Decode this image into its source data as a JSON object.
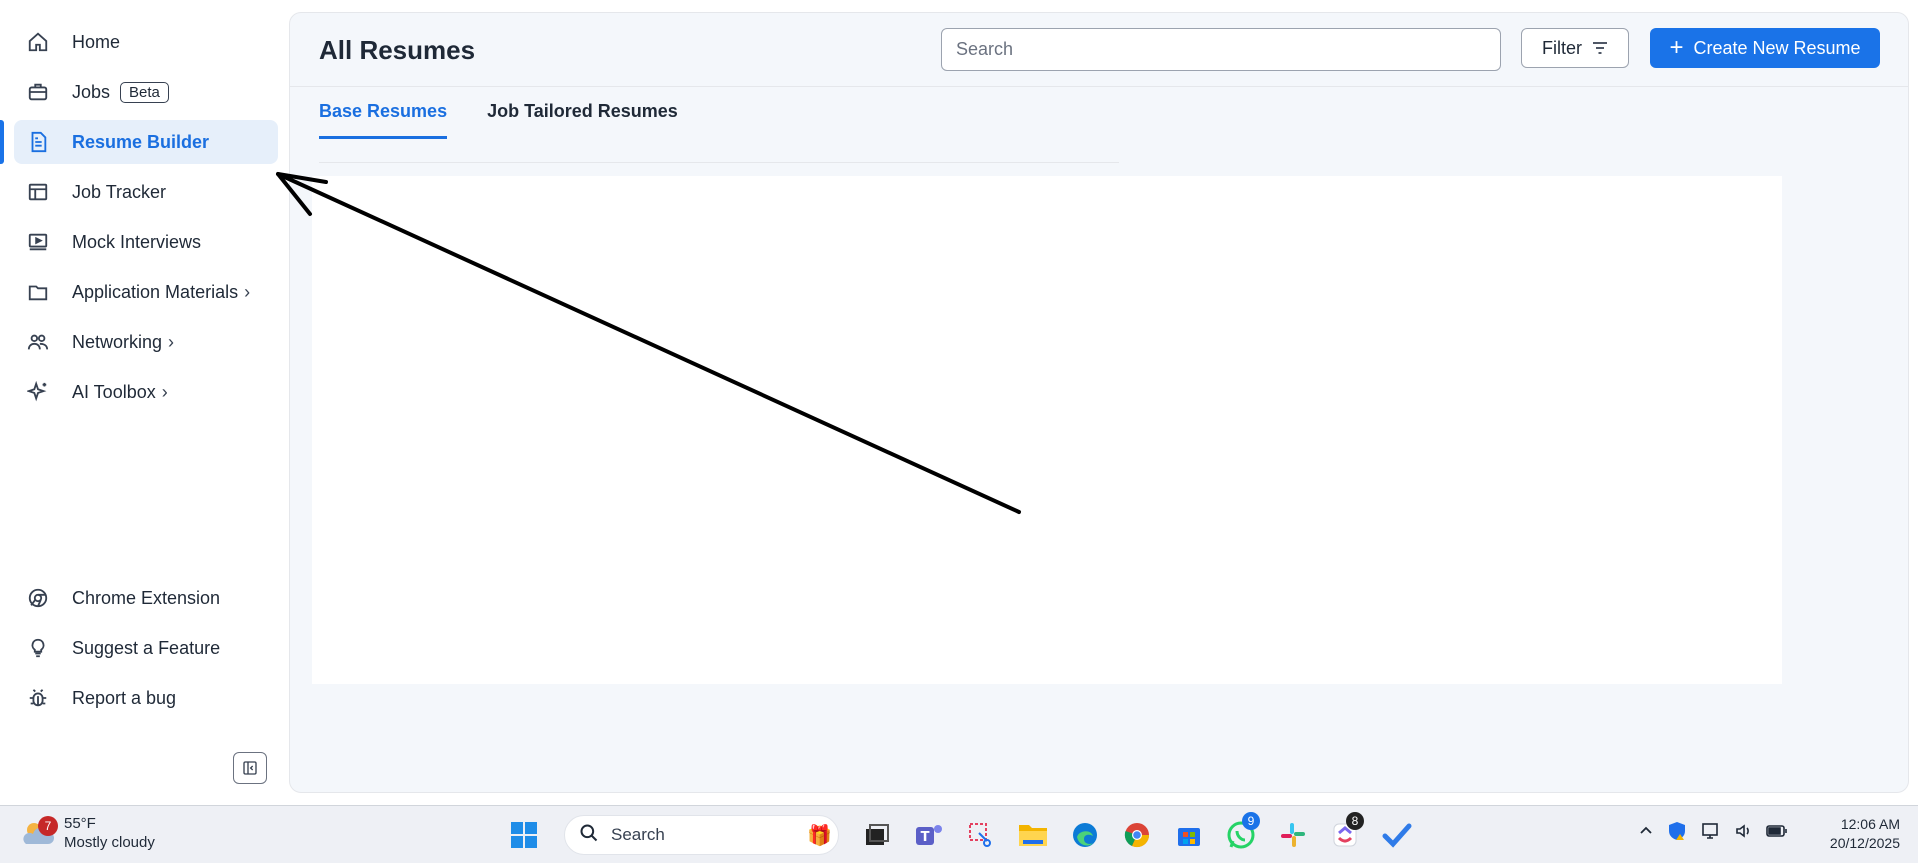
{
  "sidebar": {
    "items": [
      {
        "label": "Home",
        "icon": "home-icon"
      },
      {
        "label": "Jobs",
        "badge": "Beta",
        "icon": "briefcase-icon"
      },
      {
        "label": "Resume Builder",
        "icon": "document-icon",
        "active": true
      },
      {
        "label": "Job Tracker",
        "icon": "table-icon"
      },
      {
        "label": "Mock Interviews",
        "icon": "play-screen-icon"
      },
      {
        "label": "Application Materials",
        "icon": "folder-icon"
      },
      {
        "label": "Networking",
        "icon": "people-icon"
      },
      {
        "label": "AI Toolbox",
        "icon": "sparkle-icon"
      }
    ],
    "bottom_items": [
      {
        "label": "Chrome Extension",
        "icon": "chrome-icon"
      },
      {
        "label": "Suggest a Feature",
        "icon": "lightbulb-icon"
      },
      {
        "label": "Report a bug",
        "icon": "bug-icon"
      }
    ]
  },
  "header": {
    "title": "All Resumes",
    "search_placeholder": "Search",
    "filter_label": "Filter",
    "create_label": "Create New Resume"
  },
  "tabs": [
    {
      "label": "Base Resumes",
      "active": true
    },
    {
      "label": "Job Tailored Resumes"
    }
  ],
  "taskbar": {
    "weather": {
      "badge": "7",
      "temp": "55°F",
      "condition": "Mostly cloudy"
    },
    "search_label": "Search",
    "whatsapp_count": "9",
    "app_count": "8",
    "time": "12:06 AM",
    "date": "20/12/2025"
  },
  "colors": {
    "accent": "#1a73e8",
    "active_bg": "#e6effa",
    "panel_bg": "#f4f7fb"
  }
}
